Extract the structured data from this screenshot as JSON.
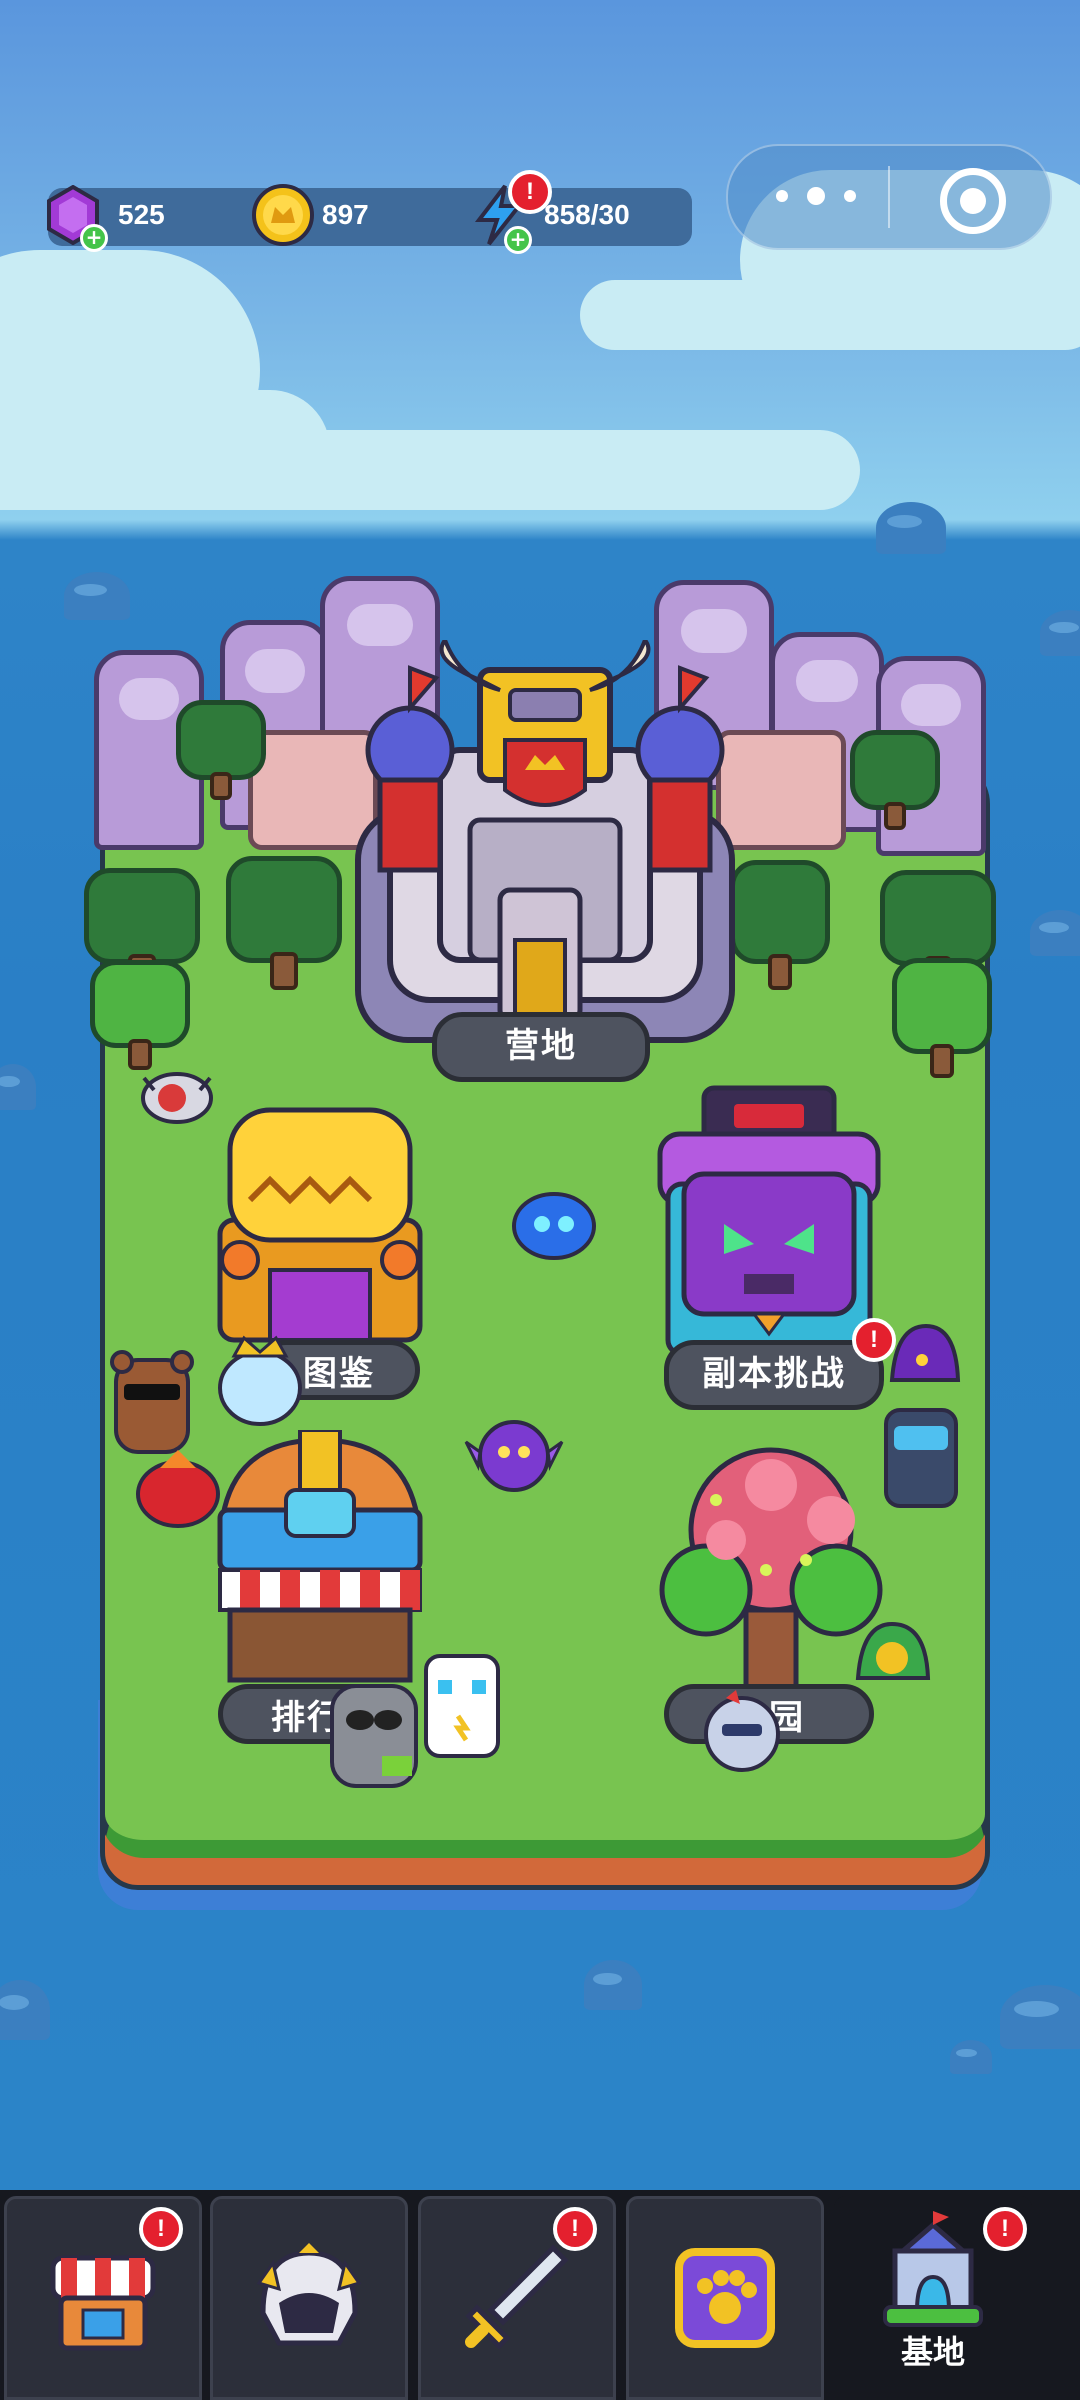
{
  "resources": {
    "gems": "525",
    "coins": "897",
    "energy": "858/30"
  },
  "alerts": {
    "mark": "!"
  },
  "buildings": {
    "camp": "营地",
    "collection": "图鉴",
    "dungeon": "副本挑战",
    "ranking": "排行",
    "garden": "园"
  },
  "nav": {
    "tabs": [
      {
        "name": "shop",
        "label": ""
      },
      {
        "name": "hero",
        "label": ""
      },
      {
        "name": "battle",
        "label": ""
      },
      {
        "name": "pet",
        "label": ""
      },
      {
        "name": "base",
        "label": "基地"
      }
    ],
    "active": "base"
  },
  "colors": {
    "gem": "#a23ad6",
    "coin": "#f4c21a",
    "energy": "#2ea0f0",
    "alert": "#e4202e",
    "grass": "#78c450",
    "sea": "#2a7fc6"
  }
}
